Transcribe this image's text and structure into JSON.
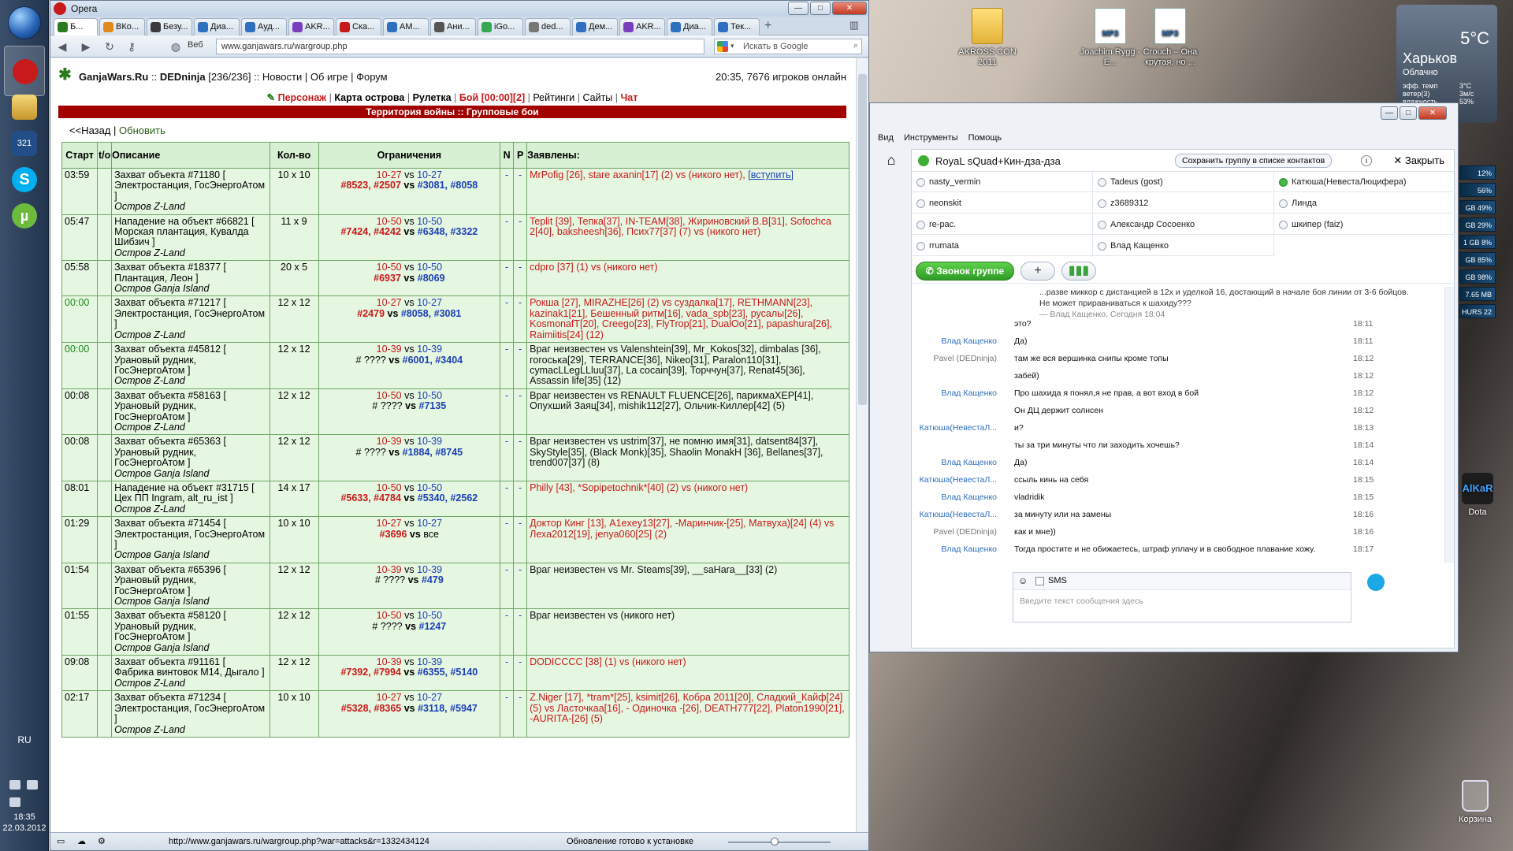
{
  "taskbar": {
    "lang": "RU",
    "time": "18:35",
    "date": "22.03.2012"
  },
  "desktop": {
    "icons": [
      {
        "label": "AKROSS CON 2011"
      },
      {
        "label": "Joachim Rygg - E..."
      },
      {
        "label": "Crouch – Она крутая, но ..."
      }
    ],
    "trash_label": "Корзина",
    "alkar_label": "Dota"
  },
  "weather": {
    "temp": "5°C",
    "city": "Харьков",
    "condition": "Облачно",
    "detail_labels": "эфф. темп\nветер(3)\nвлажность",
    "detail_values": "3°C\n3м/с\n53%"
  },
  "meters": [
    "12%",
    "56%",
    "GB 49%",
    "GB 29%",
    "1 GB 8%",
    "GB 85%",
    "GB 98%",
    "7.65 MB",
    "HURS 22"
  ],
  "opera": {
    "title": "Opera",
    "tabs": [
      "Б...",
      "ВКо...",
      "Безу...",
      "Диа...",
      "Ауд...",
      "AKR...",
      "Ска...",
      "AM...",
      "Ани...",
      "iGo...",
      "ded...",
      "Дем...",
      "AKR...",
      "Диа...",
      "Тек..."
    ],
    "web_label": "Веб",
    "url": "www.ganjawars.ru/wargroup.php",
    "search_placeholder": "Искать в Google",
    "status_url": "http://www.ganjawars.ru/wargroup.php?war=attacks&r=1332434124",
    "status_text": "Обновление готово к установке"
  },
  "gw": {
    "brand": "GanjaWars.Ru",
    "user": "DEDninja",
    "user_stats": "[236/236]",
    "header_links": [
      "Новости",
      "Об игре",
      "Форум"
    ],
    "online": "20:35, 7676 игроков онлайн",
    "menu": [
      "Персонаж",
      "Карта острова",
      "Рулетка",
      "Бой [00:00][2]",
      "Рейтинги",
      "Сайты",
      "Чат"
    ],
    "banner": "Территория войны :: Групповые бои",
    "back_link": "<<Назад",
    "refresh_link": "Обновить",
    "columns": [
      "Старт",
      "t/o",
      "Описание",
      "Кол-во",
      "Ограничения",
      "N",
      "P",
      "Заявлены:"
    ],
    "rows": [
      {
        "start": "03:59",
        "green": false,
        "desc": "Захват объекта #71180 [ Электростанция, ГосЭнергоАтом ]",
        "island": "Остров Z-Land",
        "size": "10 x 10",
        "lim_a": "10-27",
        "lim_b": "10-27",
        "ids_a": "#8523, #2507",
        "ids_b": "#3081, #8058",
        "apps": "MrPofig [26], stare axanin[17] (2) vs (никого нет),",
        "join": "[вступить]"
      },
      {
        "start": "05:47",
        "green": false,
        "desc": "Нападение на объект #66821 [ Морская плантация, Кувалда Шибзич ]",
        "island": "Остров Z-Land",
        "size": "11 x 9",
        "lim_a": "10-50",
        "lim_b": "10-50",
        "ids_a": "#7424, #4242",
        "ids_b": "#6348, #3322",
        "apps": "Teplit [39], Тепка[37], IN-TEAM[38], Жириновский В.В[31], Sofochca 2[40], baksheesh[36], Псих77[37] (7) vs (никого нет)"
      },
      {
        "start": "05:58",
        "green": false,
        "desc": "Захват объекта #18377 [ Плантация, Леон ]",
        "island": "Остров Ganja Island",
        "size": "20 x 5",
        "lim_a": "10-50",
        "lim_b": "10-50",
        "ids_a": "#6937",
        "ids_b": "#8069",
        "apps": "cdpro [37] (1) vs (никого нет)"
      },
      {
        "start": "00:00",
        "green": true,
        "desc": "Захват объекта #71217 [ Электростанция, ГосЭнергоАтом ]",
        "island": "Остров Z-Land",
        "size": "12 x 12",
        "lim_a": "10-27",
        "lim_b": "10-27",
        "ids_a": "#2479",
        "ids_b": "#8058, #3081",
        "apps": "Рокша [27], MIRAZHE[26] (2) vs суздалка[17], RETHMANN[23], kazinak1[21], Бешенный ритм[16], vada_spb[23], русалы[26], KosmonafT[20], Creego[23], FlyTrop[21], DualOo[21], papashura[26], Raimiitis[24] (12)"
      },
      {
        "start": "00:00",
        "green": true,
        "desc": "Захват объекта #45812 [ Урановый рудник, ГосЭнергоАтом ]",
        "island": "Остров Z-Land",
        "size": "12 x 12",
        "lim_a": "10-39",
        "lim_b": "10-39",
        "ids_a": "# ????",
        "ids_b": "#6001, #3404",
        "apps": "Враг неизвестен vs Valenshtein[39], Mr_Kokos[32], dimbalas [36], гогоська[29], TERRANCE[36], Nikeo[31], Paralon110[31], cymacLLegLLluu[37], La cocain[39], Торччун[37], Renat45[36], Assassin life[35] (12)"
      },
      {
        "start": "00:08",
        "green": false,
        "desc": "Захват объекта #58163 [ Урановый рудник, ГосЭнергоАтом ]",
        "island": "Остров Z-Land",
        "size": "12 x 12",
        "lim_a": "10-50",
        "lim_b": "10-50",
        "ids_a": "# ????",
        "ids_b": "#7135",
        "apps": "Враг неизвестен vs RENAULT FLUENCE[26], парикмаХЕР[41], Опухший Заяц[34], mishik112[27], Ольчик-Киллер[42] (5)"
      },
      {
        "start": "00:08",
        "green": false,
        "desc": "Захват объекта #65363 [ Урановый рудник, ГосЭнергоАтом ]",
        "island": "Остров Ganja Island",
        "size": "12 x 12",
        "lim_a": "10-39",
        "lim_b": "10-39",
        "ids_a": "# ????",
        "ids_b": "#1884, #8745",
        "apps": "Враг неизвестен vs ustrim[37], не помню имя[31], datsent84[37], SkyStyle[35], (Black Monk)[35], Shaolin MonakH [36], Bellanes[37], trend007[37] (8)"
      },
      {
        "start": "08:01",
        "green": false,
        "desc": "Нападение на объект #31715 [ Цех ПП Ingram, alt_ru_ist ]",
        "island": "Остров Z-Land",
        "size": "14 x 17",
        "lim_a": "10-50",
        "lim_b": "10-50",
        "ids_a": "#5633, #4784",
        "ids_b": "#5340, #2562",
        "apps": "Philly [43], *Sopipetochnik*[40] (2) vs (никого нет)"
      },
      {
        "start": "01:29",
        "green": false,
        "desc": "Захват объекта #71454 [ Электростанция, ГосЭнергоАтом ]",
        "island": "Остров Ganja Island",
        "size": "10 x 10",
        "lim_a": "10-27",
        "lim_b": "10-27",
        "ids_a": "#3696",
        "ids_b": "все",
        "apps": "Доктор Кинг [13], A1exey13[27], -Маринчик-[25], Матвуха)[24] (4) vs Леха2012[19], jenya060[25] (2)"
      },
      {
        "start": "01:54",
        "green": false,
        "desc": "Захват объекта #65396 [ Урановый рудник, ГосЭнергоАтом ]",
        "island": "Остров Ganja Island",
        "size": "12 x 12",
        "lim_a": "10-39",
        "lim_b": "10-39",
        "ids_a": "# ????",
        "ids_b": "#479",
        "apps": "Враг неизвестен vs Mr. Steams[39], __saHara__[33] (2)"
      },
      {
        "start": "01:55",
        "green": false,
        "desc": "Захват объекта #58120 [ Урановый рудник, ГосЭнергоАтом ]",
        "island": "Остров Ganja Island",
        "size": "12 x 12",
        "lim_a": "10-50",
        "lim_b": "10-50",
        "ids_a": "# ????",
        "ids_b": "#1247",
        "apps": "Враг неизвестен vs (никого нет)"
      },
      {
        "start": "09:08",
        "green": false,
        "desc": "Захват объекта #91161 [ Фабрика винтовок M14, Дыгало ]",
        "island": "Остров Z-Land",
        "size": "12 x 12",
        "lim_a": "10-39",
        "lim_b": "10-39",
        "ids_a": "#7392, #7994",
        "ids_b": "#6355, #5140",
        "apps": "DODICCCC [38] (1) vs (никого нет)"
      },
      {
        "start": "02:17",
        "green": false,
        "desc": "Захват объекта #71234 [ Электростанция, ГосЭнергоАтом ]",
        "island": "Остров Z-Land",
        "size": "10 x 10",
        "lim_a": "10-27",
        "lim_b": "10-27",
        "ids_a": "#5328, #8365",
        "ids_b": "#3118, #5947",
        "apps": "Z.Niger [17], *tram*[25], ksimit[26], Кобра 2011[20], Сладкий_Кайф[24] (5) vs Ласточкаа[16], - Одиночка -[26], DEATH777[22], Platon1990[21], -AURITA-[26] (5)"
      }
    ]
  },
  "chat": {
    "menu": [
      "Вид",
      "Инструменты",
      "Помощь"
    ],
    "title": "RoyaL sQuad+Кин-дза-дза",
    "save_group": "Сохранить группу в списке контактов",
    "close": "Закрыть",
    "members": [
      {
        "name": "nasty_vermin",
        "online": false
      },
      {
        "name": "Tadeus (gost)",
        "online": false
      },
      {
        "name": "Катюша(НевестаЛюцифера)",
        "online": true
      },
      {
        "name": "neonskit",
        "online": false
      },
      {
        "name": "z3689312",
        "online": false
      },
      {
        "name": "Линда",
        "online": false
      },
      {
        "name": "re-pac.",
        "online": false
      },
      {
        "name": "Александр Сосоенко",
        "online": false
      },
      {
        "name": "шкипер (faiz)",
        "online": false
      },
      {
        "name": "rrumata",
        "online": false
      },
      {
        "name": "Влад Кащенко",
        "online": false
      }
    ],
    "call_button": "Звонок группе",
    "quote_text": "...разве миккор с дистанцией в 12х и уделкой 16, достающий в начале боя линии от 3-6 бойцов. Не может приравниваться к шахиду???",
    "quote_meta": "— Влад Кащенко, Сегодня 18:04",
    "messages": [
      {
        "author": "",
        "text": "это?",
        "time": "18:11",
        "grey": false
      },
      {
        "author": "Влад Кащенко",
        "text": "Да)",
        "time": "18:11",
        "grey": false
      },
      {
        "author": "Pavel (DEDninja)",
        "text": "там же вся вершинка снипы кроме топы",
        "time": "18:12",
        "grey": true
      },
      {
        "author": "",
        "text": "забей)",
        "time": "18:12",
        "grey": false
      },
      {
        "author": "Влад Кащенко",
        "text": "Про шахида я понял,я не прав, а вот вход в бой",
        "time": "18:12",
        "grey": false
      },
      {
        "author": "",
        "text": "Он ДЦ держит солнсен",
        "time": "18:12",
        "grey": false
      },
      {
        "author": "Катюша(НевестаЛ...",
        "text": "и?",
        "time": "18:13",
        "grey": false
      },
      {
        "author": "",
        "text": "ты за три минуты что ли заходить хочешь?",
        "time": "18:14",
        "grey": false
      },
      {
        "author": "Влад Кащенко",
        "text": "Да)",
        "time": "18:14",
        "grey": false
      },
      {
        "author": "Катюша(НевестаЛ...",
        "text": "ссыль кинь на себя",
        "time": "18:15",
        "grey": false
      },
      {
        "author": "Влад Кащенко",
        "text": "vladridik",
        "time": "18:15",
        "grey": false
      },
      {
        "author": "Катюша(НевестаЛ...",
        "text": "за минуту или на замены",
        "time": "18:16",
        "grey": false
      },
      {
        "author": "Pavel (DEDninja)",
        "text": "как и мне))",
        "time": "18:16",
        "grey": true
      },
      {
        "author": "Влад Кащенко",
        "text": "Тогда простите и не обижаетесь, штраф уплачу и в свободное плавание хожу.",
        "time": "18:17",
        "grey": false
      }
    ],
    "sms_label": "SMS",
    "composer_placeholder": "Введите текст сообщения здесь"
  }
}
